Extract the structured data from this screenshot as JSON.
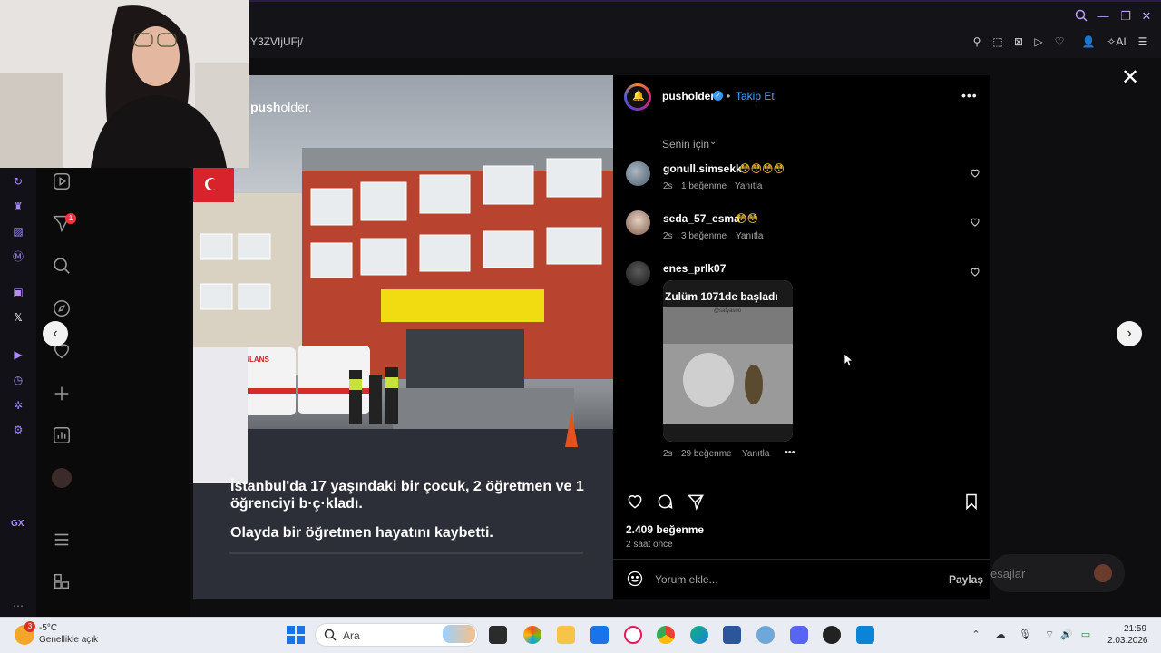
{
  "browser": {
    "url_fragment": "Y3ZVIjUFj/",
    "ai_label": "AI"
  },
  "post": {
    "brand_bold": "push",
    "brand_rest": "older.",
    "caption_line1": "İstanbul'da 17 yaşındaki bir çocuk, 2 öğretmen ve 1 öğrenciyi b·ç·kladı.",
    "caption_line2": "Olayda bir öğretmen hayatını kaybetti.",
    "ambulance_text": "AMBULANS"
  },
  "panel": {
    "username": "pusholder",
    "verified": "✓",
    "separator": "•",
    "follow_label": "Takip Et",
    "more": "•••",
    "sort_label": "Senin için",
    "likes": "2.409 beğenme",
    "time_ago": "2 saat önce",
    "comment_placeholder": "Yorum ekle...",
    "share_label": "Paylaş"
  },
  "comments": [
    {
      "user": "gonull.simsekk",
      "emoji": "😳😳😳😳",
      "age": "2s",
      "likes": "1 beğenme",
      "reply": "Yanıtla"
    },
    {
      "user": "seda_57_esma",
      "emoji": "😳😳",
      "age": "2s",
      "likes": "3 beğenme",
      "reply": "Yanıtla"
    },
    {
      "user": "enes_prlk07",
      "age": "2s",
      "likes": "29 beğenme",
      "reply": "Yanıtla",
      "more": "•••",
      "gif_title": "Zulüm 1071de başladı",
      "gif_handle": "@safyasoo"
    }
  ],
  "background": {
    "messages_text": "esajlar"
  },
  "sidebar": {
    "gx_label": "GX",
    "badge": "1"
  },
  "taskbar": {
    "weather_temp": "-5°C",
    "weather_desc": "Genellikle açık",
    "weather_badge": "3",
    "search_label": "Ara",
    "time": "21:59",
    "date": "2.03.2026"
  },
  "colors": {
    "follow": "#4aa3ff",
    "verified": "#3897f0",
    "opera_accent": "#a78bfa",
    "taskbar_bg": "#e9edf3"
  }
}
